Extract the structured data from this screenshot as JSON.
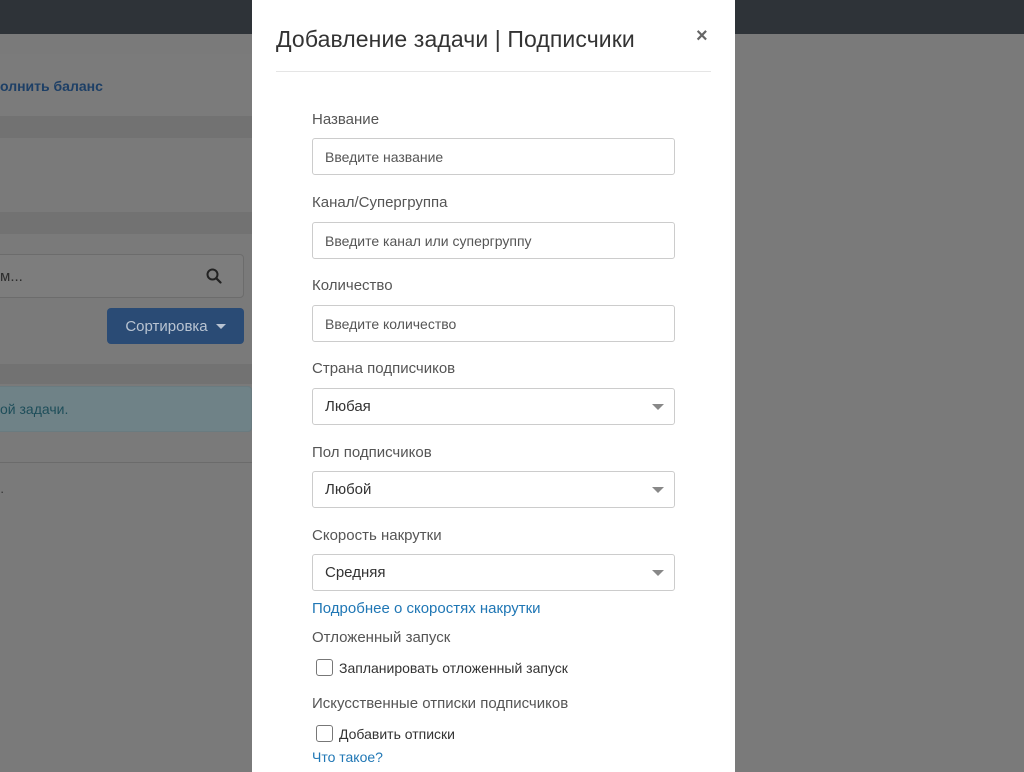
{
  "background": {
    "balance_link": "олнить баланс",
    "search_placeholder": "м...",
    "sort_button": "Сортировка",
    "alert_text": "ой задачи."
  },
  "modal": {
    "title": "Добавление задачи | Подписчики",
    "close": "×",
    "fields": {
      "name": {
        "label": "Название",
        "placeholder": "Введите название"
      },
      "channel": {
        "label": "Канал/Супергруппа",
        "placeholder": "Введите канал или супергруппу"
      },
      "quantity": {
        "label": "Количество",
        "placeholder": "Введите количество"
      },
      "country": {
        "label": "Страна подписчиков",
        "value": "Любая"
      },
      "gender": {
        "label": "Пол подписчиков",
        "value": "Любой"
      },
      "speed": {
        "label": "Скорость накрутки",
        "value": "Средняя",
        "help_link": "Подробнее о скоростях накрутки"
      },
      "delayed": {
        "label": "Отложенный запуск",
        "checkbox_label": "Запланировать отложенный запуск"
      },
      "unsubscribes": {
        "label": "Искусственные отписки подписчиков",
        "checkbox_label": "Добавить отписки",
        "help_link": "Что такое?"
      }
    }
  }
}
